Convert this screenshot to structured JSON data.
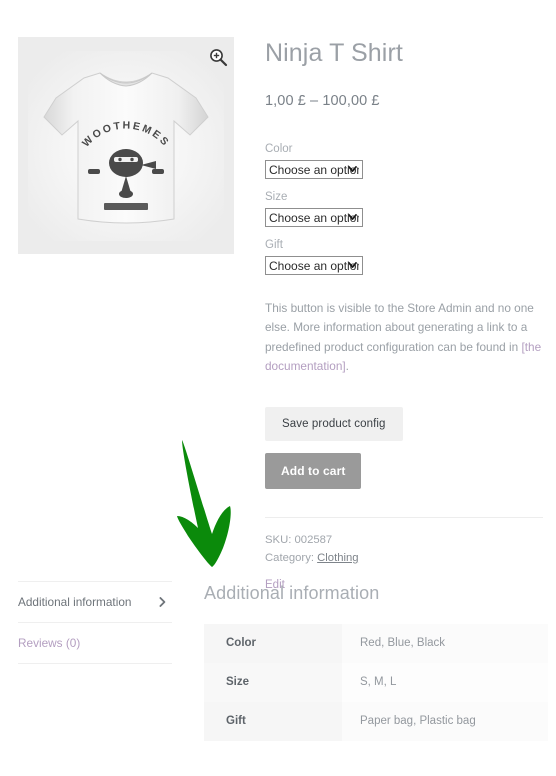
{
  "product": {
    "title": "Ninja T Shirt",
    "price": "1,00 £ – 100,00 £",
    "image_alt": "Ninja T Shirt product photo",
    "shirt_graphic_text": "WOOTHEMES",
    "zoom_icon": "magnifier-plus-icon"
  },
  "variations": [
    {
      "label": "Color",
      "selected": "Choose an option"
    },
    {
      "label": "Size",
      "selected": "Choose an option"
    },
    {
      "label": "Gift",
      "selected": "Choose an option"
    }
  ],
  "admin_note": {
    "text_before": "This button is visible to the Store Admin and no one else. More information about generating a link to a predefined product configuration can be found in ",
    "link_text": "[the documentation]",
    "text_after": "."
  },
  "buttons": {
    "save_config": "Save product config",
    "add_to_cart": "Add to cart"
  },
  "meta": {
    "sku_label": "SKU:",
    "sku_value": "002587",
    "category_label": "Category:",
    "category_value": "Clothing",
    "edit_label": "Edit"
  },
  "tabs": [
    {
      "label": "Additional information",
      "state": "active"
    },
    {
      "label": "Reviews (0)",
      "state": "link"
    }
  ],
  "info_panel": {
    "heading": "Additional information",
    "rows": [
      {
        "name": "Color",
        "value": "Red, Blue, Black"
      },
      {
        "name": "Size",
        "value": "S, M, L"
      },
      {
        "name": "Gift",
        "value": "Paper bag, Plastic bag"
      }
    ]
  },
  "annotation": {
    "type": "green-arrow",
    "color": "#0b8a0b",
    "direction": "down-right"
  },
  "colors": {
    "link": "#b39ec0",
    "muted_text": "#9aa0a6",
    "button_primary_bg": "#9a9a9a",
    "button_secondary_bg": "#f0f0f0",
    "arrow_green": "#0b8a0b"
  }
}
